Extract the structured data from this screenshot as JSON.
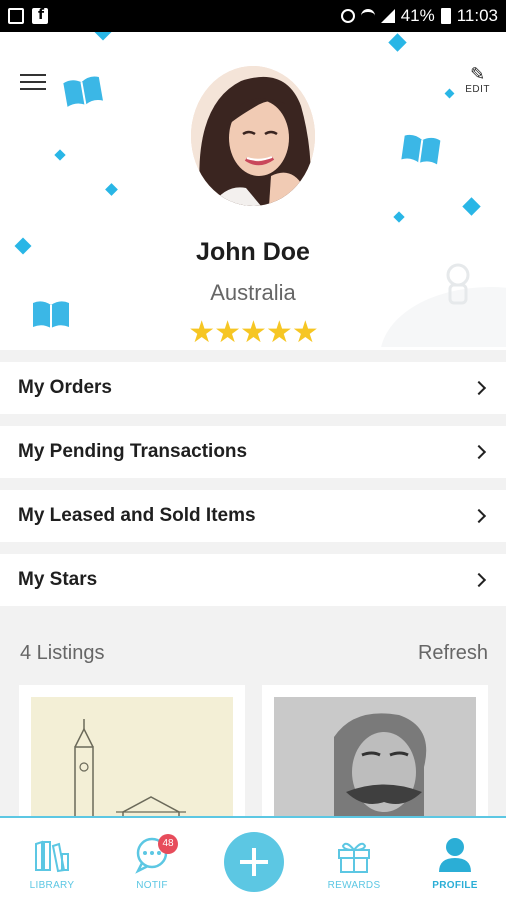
{
  "status_bar": {
    "battery": "41%",
    "time": "11:03"
  },
  "header": {
    "edit_label": "EDIT"
  },
  "profile": {
    "name": "John Doe",
    "country": "Australia",
    "rating": 5,
    "stars_text": "★★★★★"
  },
  "menu": {
    "items": [
      {
        "label": "My Orders"
      },
      {
        "label": "My Pending Transactions"
      },
      {
        "label": "My Leased and Sold Items"
      },
      {
        "label": "My Stars"
      }
    ]
  },
  "listings": {
    "count_label": "4 Listings",
    "refresh_label": "Refresh"
  },
  "bottom_nav": {
    "library": "LIBRARY",
    "notif": "NOTIF",
    "notif_badge": "48",
    "rewards": "REWARDS",
    "profile": "PROFILE"
  },
  "colors": {
    "accent": "#5cc7e3",
    "diamond": "#29b6e6",
    "star": "#f6c623",
    "badge": "#e74c5b"
  }
}
